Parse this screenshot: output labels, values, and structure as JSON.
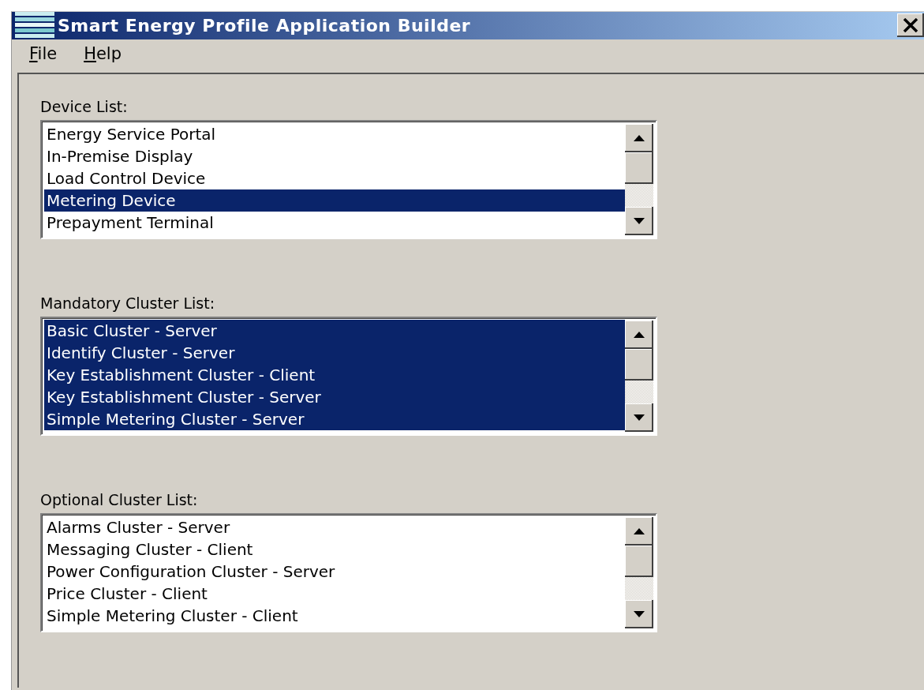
{
  "window": {
    "title": "Smart Energy Profile Application Builder"
  },
  "menu": [
    {
      "label": "File"
    },
    {
      "label": "Help"
    }
  ],
  "lists": [
    {
      "label": "Device List:",
      "items": [
        {
          "text": "Energy Service Portal",
          "selected": false
        },
        {
          "text": "In-Premise Display",
          "selected": false
        },
        {
          "text": "Load Control Device",
          "selected": false
        },
        {
          "text": "Metering Device",
          "selected": true
        },
        {
          "text": "Prepayment Terminal",
          "selected": false
        }
      ]
    },
    {
      "label": "Mandatory Cluster List:",
      "items": [
        {
          "text": "Basic Cluster - Server",
          "selected": true
        },
        {
          "text": "Identify Cluster - Server",
          "selected": true
        },
        {
          "text": "Key Establishment Cluster - Client",
          "selected": true
        },
        {
          "text": "Key Establishment Cluster - Server",
          "selected": true
        },
        {
          "text": "Simple Metering Cluster - Server",
          "selected": true
        }
      ]
    },
    {
      "label": "Optional Cluster List:",
      "items": [
        {
          "text": "Alarms Cluster - Server",
          "selected": false
        },
        {
          "text": "Messaging Cluster - Client",
          "selected": false
        },
        {
          "text": "Power Configuration Cluster - Server",
          "selected": false
        },
        {
          "text": "Price Cluster - Client",
          "selected": false
        },
        {
          "text": "Simple Metering Cluster - Client",
          "selected": false
        }
      ]
    }
  ]
}
